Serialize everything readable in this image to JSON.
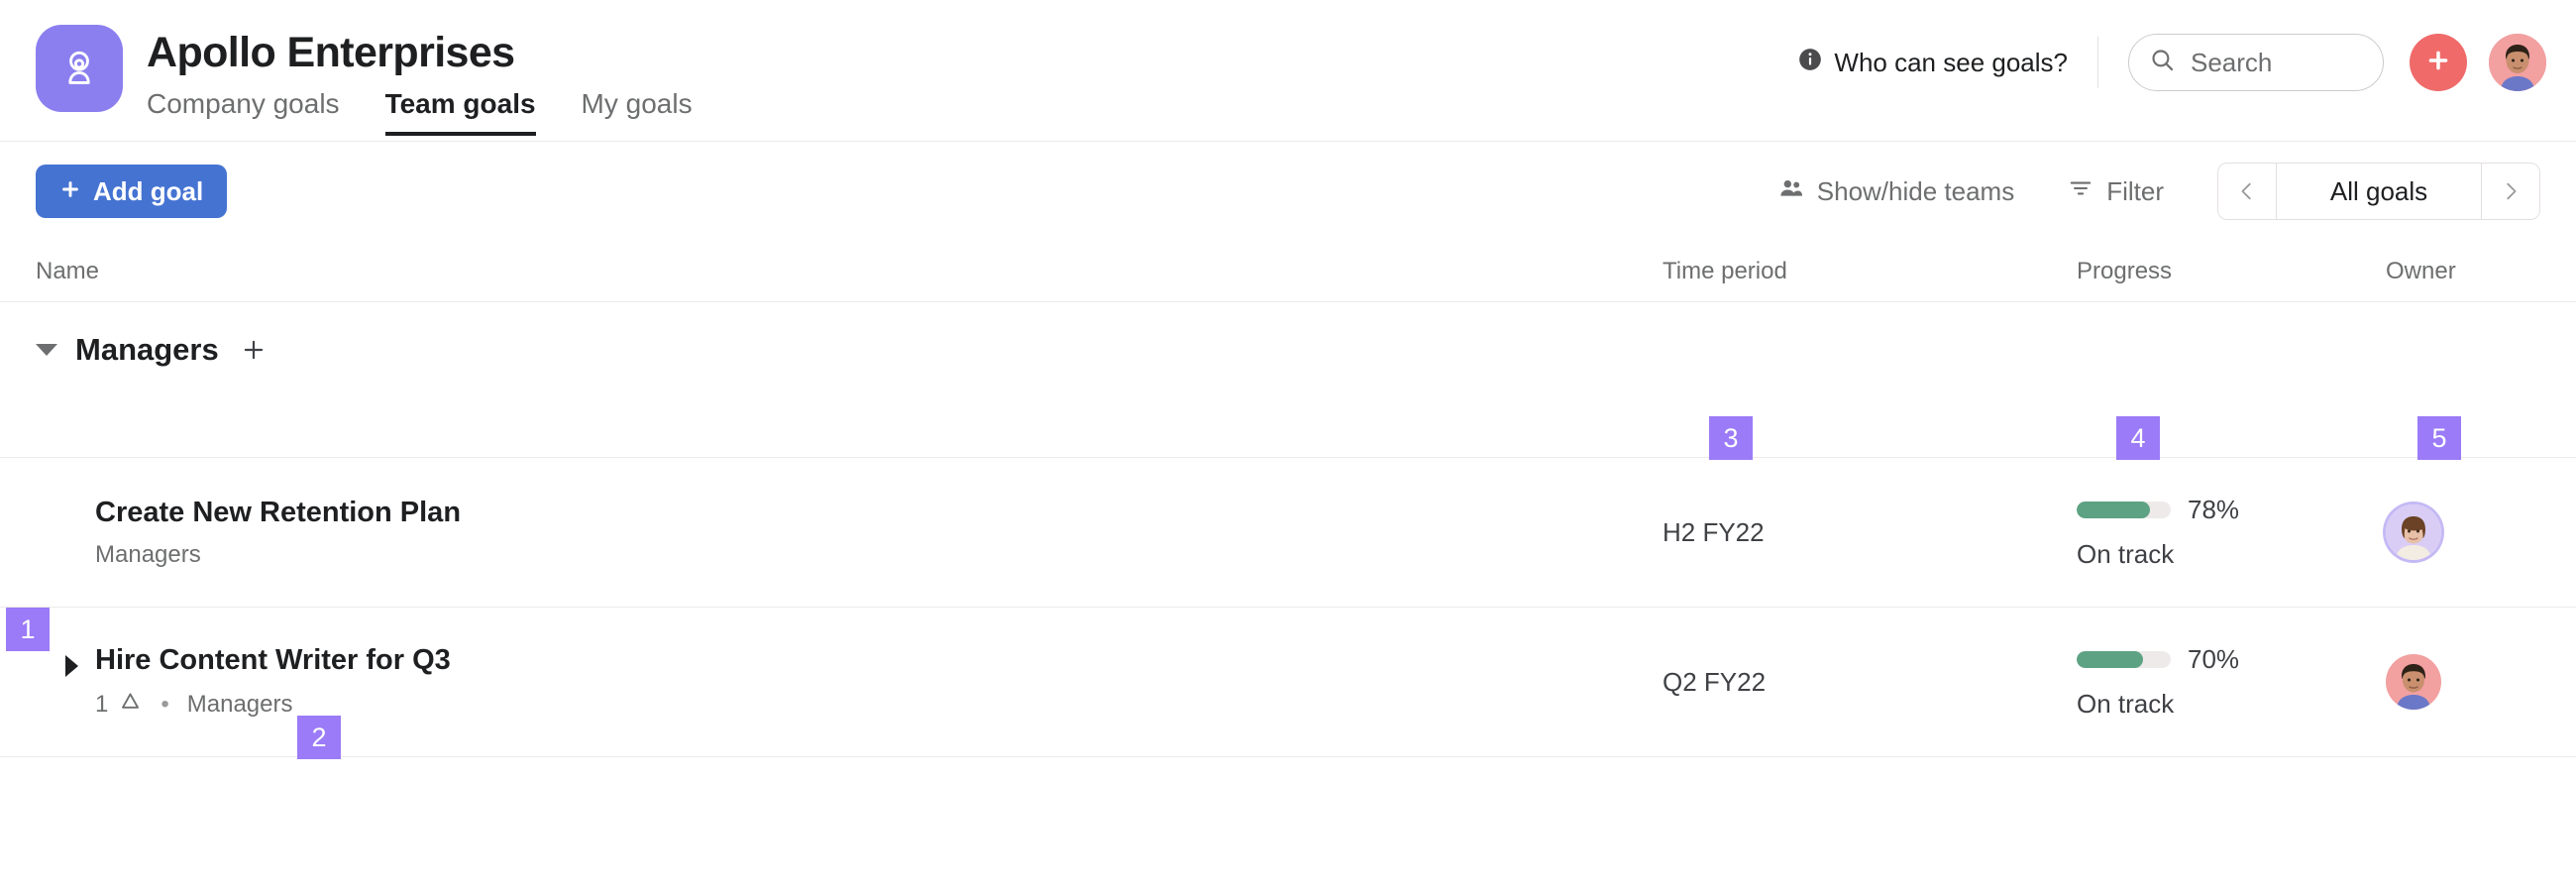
{
  "header": {
    "logo_icon": "person-badge-icon",
    "logo_color": "#8b7ff0",
    "title": "Apollo Enterprises",
    "tabs": [
      {
        "label": "Company goals",
        "active": false
      },
      {
        "label": "Team goals",
        "active": true
      },
      {
        "label": "My goals",
        "active": false
      }
    ],
    "who_can_see": {
      "icon": "info-icon",
      "label": "Who can see goals?"
    },
    "search": {
      "icon": "search-icon",
      "placeholder": "Search",
      "value": ""
    },
    "create_button": {
      "icon": "plus-icon",
      "label": "+",
      "color": "#f06a6a"
    },
    "account_avatar": "user-avatar"
  },
  "toolbar": {
    "add_goal": {
      "icon": "plus-icon",
      "label": "Add goal",
      "color": "#4573d2"
    },
    "show_hide_teams": {
      "icon": "people-icon",
      "label": "Show/hide teams"
    },
    "filter": {
      "icon": "filter-icon",
      "label": "Filter"
    },
    "goal_selector": {
      "prev_icon": "chevron-left-icon",
      "label": "All goals",
      "next_icon": "chevron-right-icon"
    }
  },
  "table": {
    "columns": [
      {
        "key": "name",
        "label": "Name"
      },
      {
        "key": "time_period",
        "label": "Time period"
      },
      {
        "key": "progress",
        "label": "Progress"
      },
      {
        "key": "owner",
        "label": "Owner"
      }
    ],
    "groups": [
      {
        "name": "Managers",
        "expanded": true,
        "collapse_icon": "caret-down-icon",
        "add_icon": "plus-icon",
        "rows": [
          {
            "title": "Create New Retention Plan",
            "subtitle_team": "Managers",
            "has_expander": false,
            "subgoal_count": null,
            "subgoal_icon": null,
            "time_period": "H2 FY22",
            "progress_pct": 78,
            "progress_label": "78%",
            "status": "On track",
            "status_color": "#5da283",
            "owner": "owner-avatar-female",
            "owner_ring": true
          },
          {
            "title": "Hire Content Writer for Q3",
            "subtitle_team": "Managers",
            "has_expander": true,
            "expander_icon": "caret-right-icon",
            "subgoal_count": "1",
            "subgoal_icon": "goal-triangle-icon",
            "time_period": "Q2 FY22",
            "progress_pct": 70,
            "progress_label": "70%",
            "status": "On track",
            "status_color": "#5da283",
            "owner": "owner-avatar-male",
            "owner_ring": false
          }
        ]
      }
    ]
  },
  "annotations": [
    {
      "id": "1",
      "label": "1"
    },
    {
      "id": "2",
      "label": "2"
    },
    {
      "id": "3",
      "label": "3"
    },
    {
      "id": "4",
      "label": "4"
    },
    {
      "id": "5",
      "label": "5"
    }
  ]
}
